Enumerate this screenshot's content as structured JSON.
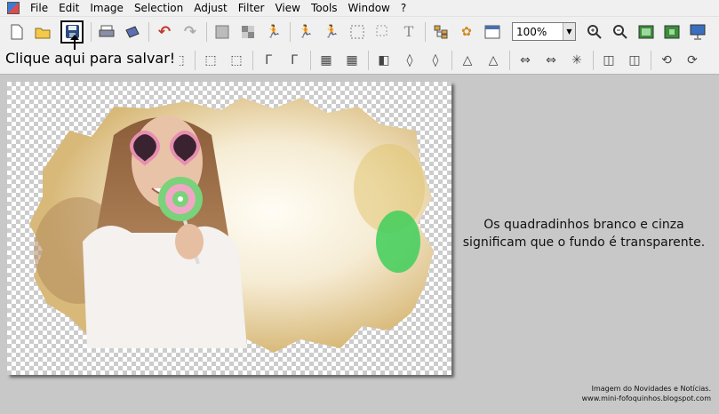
{
  "menu": [
    "File",
    "Edit",
    "Image",
    "Selection",
    "Adjust",
    "Filter",
    "View",
    "Tools",
    "Window",
    "?"
  ],
  "toolbar": {
    "zoom_value": "100%",
    "icons_row1": [
      "new-file-icon",
      "open-folder-icon",
      "save-icon",
      "print-icon",
      "scan-icon",
      "undo-icon",
      "redo-icon",
      "gradient-icon",
      "pattern-icon",
      "run-icon",
      "figure-icon",
      "figure-alt-icon",
      "select-icon",
      "text-icon",
      "tree-icon",
      "puzzle-icon",
      "window-icon",
      "zoom-in-icon",
      "zoom-out-icon",
      "fit-icon",
      "actual-size-icon",
      "fullscreen-icon"
    ]
  },
  "hint": "Clique aqui para salvar!",
  "note": {
    "line1": "Os quadradinhos branco e cinza",
    "line2": "significam que o fundo é transparente."
  },
  "credits": {
    "line1": "Imagem do Novidades e Notícias.",
    "line2": "www.mini-fofoquinhos.blogspot.com"
  },
  "colors": {
    "toolbar": "#f0f0f0",
    "workspace": "#c8c8c8",
    "checker": "#cccccc"
  }
}
